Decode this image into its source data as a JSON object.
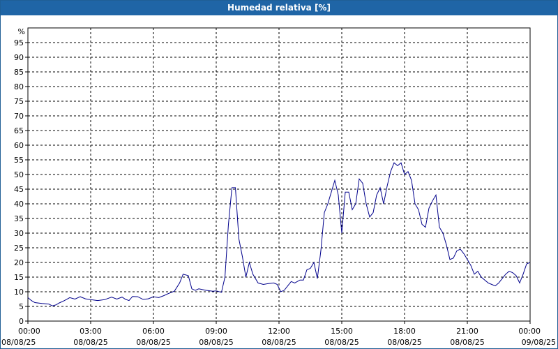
{
  "window": {
    "title": "Humedad relativa [%]"
  },
  "colors": {
    "title_bar": "#1f65a6",
    "series_line": "#00008b",
    "grid": "#000000"
  },
  "chart_data": {
    "type": "line",
    "title": "Humedad relativa [%]",
    "xlabel": "",
    "ylabel": "%",
    "ylim": [
      0,
      100
    ],
    "xlim": [
      "08/08/25 00:00",
      "09/08/25 00:00"
    ],
    "grid": true,
    "y_ticks": [
      "0",
      "5",
      "10",
      "15",
      "20",
      "25",
      "30",
      "35",
      "40",
      "45",
      "50",
      "55",
      "60",
      "65",
      "70",
      "75",
      "80",
      "85",
      "90",
      "95"
    ],
    "x_ticks": [
      {
        "time": "00:00",
        "date": "08/08/25"
      },
      {
        "time": "03:00",
        "date": "08/08/25"
      },
      {
        "time": "06:00",
        "date": "08/08/25"
      },
      {
        "time": "09:00",
        "date": "08/08/25"
      },
      {
        "time": "12:00",
        "date": "08/08/25"
      },
      {
        "time": "15:00",
        "date": "08/08/25"
      },
      {
        "time": "18:00",
        "date": "08/08/25"
      },
      {
        "time": "21:00",
        "date": "08/08/25"
      },
      {
        "time": "00:00",
        "date": "09/08/25"
      }
    ],
    "series": [
      {
        "values": [
          [
            "00:00",
            8
          ],
          [
            "00:10",
            7
          ],
          [
            "00:20",
            6.3
          ],
          [
            "00:40",
            6
          ],
          [
            "01:00",
            5.8
          ],
          [
            "01:10",
            5.2
          ],
          [
            "01:20",
            5.5
          ],
          [
            "01:30",
            6.2
          ],
          [
            "01:45",
            7
          ],
          [
            "02:00",
            8
          ],
          [
            "02:15",
            7.5
          ],
          [
            "02:30",
            8.3
          ],
          [
            "02:45",
            7.6
          ],
          [
            "03:00",
            7.3
          ],
          [
            "03:20",
            7
          ],
          [
            "03:40",
            7.3
          ],
          [
            "04:00",
            8.2
          ],
          [
            "04:15",
            7.5
          ],
          [
            "04:30",
            8.2
          ],
          [
            "04:40",
            7.4
          ],
          [
            "04:50",
            7
          ],
          [
            "05:00",
            8.4
          ],
          [
            "05:15",
            8.3
          ],
          [
            "05:30",
            7.4
          ],
          [
            "05:45",
            7.6
          ],
          [
            "06:00",
            8.3
          ],
          [
            "06:15",
            8
          ],
          [
            "06:30",
            8.7
          ],
          [
            "06:45",
            9.5
          ],
          [
            "07:00",
            10.2
          ],
          [
            "07:15",
            13
          ],
          [
            "07:25",
            16
          ],
          [
            "07:40",
            15.5
          ],
          [
            "07:50",
            11
          ],
          [
            "08:00",
            10.5
          ],
          [
            "08:10",
            11
          ],
          [
            "08:30",
            10.5
          ],
          [
            "08:50",
            10.2
          ],
          [
            "09:00",
            10.3
          ],
          [
            "09:15",
            9.8
          ],
          [
            "09:25",
            15
          ],
          [
            "09:35",
            33
          ],
          [
            "09:45",
            45.5
          ],
          [
            "09:55",
            45.5
          ],
          [
            "10:05",
            28
          ],
          [
            "10:15",
            22
          ],
          [
            "10:25",
            15
          ],
          [
            "10:35",
            20
          ],
          [
            "10:45",
            16
          ],
          [
            "11:00",
            13
          ],
          [
            "11:15",
            12.5
          ],
          [
            "11:30",
            12.8
          ],
          [
            "11:45",
            13
          ],
          [
            "11:55",
            12.5
          ],
          [
            "12:05",
            10
          ],
          [
            "12:15",
            10.5
          ],
          [
            "12:25",
            12
          ],
          [
            "12:35",
            13.5
          ],
          [
            "12:45",
            13
          ],
          [
            "13:00",
            14
          ],
          [
            "13:10",
            14
          ],
          [
            "13:20",
            17.5
          ],
          [
            "13:30",
            18
          ],
          [
            "13:40",
            20
          ],
          [
            "13:50",
            14.5
          ],
          [
            "14:00",
            24
          ],
          [
            "14:10",
            37
          ],
          [
            "14:20",
            40
          ],
          [
            "14:30",
            44
          ],
          [
            "14:40",
            48
          ],
          [
            "14:50",
            43
          ],
          [
            "15:00",
            30
          ],
          [
            "15:10",
            44
          ],
          [
            "15:20",
            44
          ],
          [
            "15:30",
            38
          ],
          [
            "15:40",
            40
          ],
          [
            "15:50",
            48.5
          ],
          [
            "16:00",
            47
          ],
          [
            "16:10",
            40
          ],
          [
            "16:20",
            35.5
          ],
          [
            "16:30",
            37
          ],
          [
            "16:40",
            43
          ],
          [
            "16:50",
            45.5
          ],
          [
            "17:00",
            40
          ],
          [
            "17:10",
            46
          ],
          [
            "17:20",
            51
          ],
          [
            "17:30",
            54
          ],
          [
            "17:40",
            53
          ],
          [
            "17:50",
            54
          ],
          [
            "18:00",
            50
          ],
          [
            "18:10",
            51
          ],
          [
            "18:20",
            48
          ],
          [
            "18:30",
            40
          ],
          [
            "18:40",
            38
          ],
          [
            "18:50",
            33
          ],
          [
            "19:00",
            32
          ],
          [
            "19:10",
            38.5
          ],
          [
            "19:20",
            41
          ],
          [
            "19:30",
            43
          ],
          [
            "19:40",
            32
          ],
          [
            "19:50",
            30
          ],
          [
            "20:00",
            26
          ],
          [
            "20:10",
            21
          ],
          [
            "20:20",
            21.5
          ],
          [
            "20:30",
            24
          ],
          [
            "20:40",
            24.5
          ],
          [
            "20:50",
            23
          ],
          [
            "21:00",
            21
          ],
          [
            "21:10",
            19
          ],
          [
            "21:20",
            16
          ],
          [
            "21:30",
            17
          ],
          [
            "21:40",
            15
          ],
          [
            "21:50",
            14
          ],
          [
            "22:00",
            13
          ],
          [
            "22:10",
            12.5
          ],
          [
            "22:20",
            12
          ],
          [
            "22:30",
            13
          ],
          [
            "22:40",
            14.5
          ],
          [
            "22:50",
            16
          ],
          [
            "23:00",
            17
          ],
          [
            "23:10",
            16.5
          ],
          [
            "23:20",
            15.5
          ],
          [
            "23:30",
            13
          ],
          [
            "23:40",
            16
          ],
          [
            "23:50",
            19.5
          ],
          [
            "24:00",
            20
          ]
        ]
      }
    ]
  }
}
